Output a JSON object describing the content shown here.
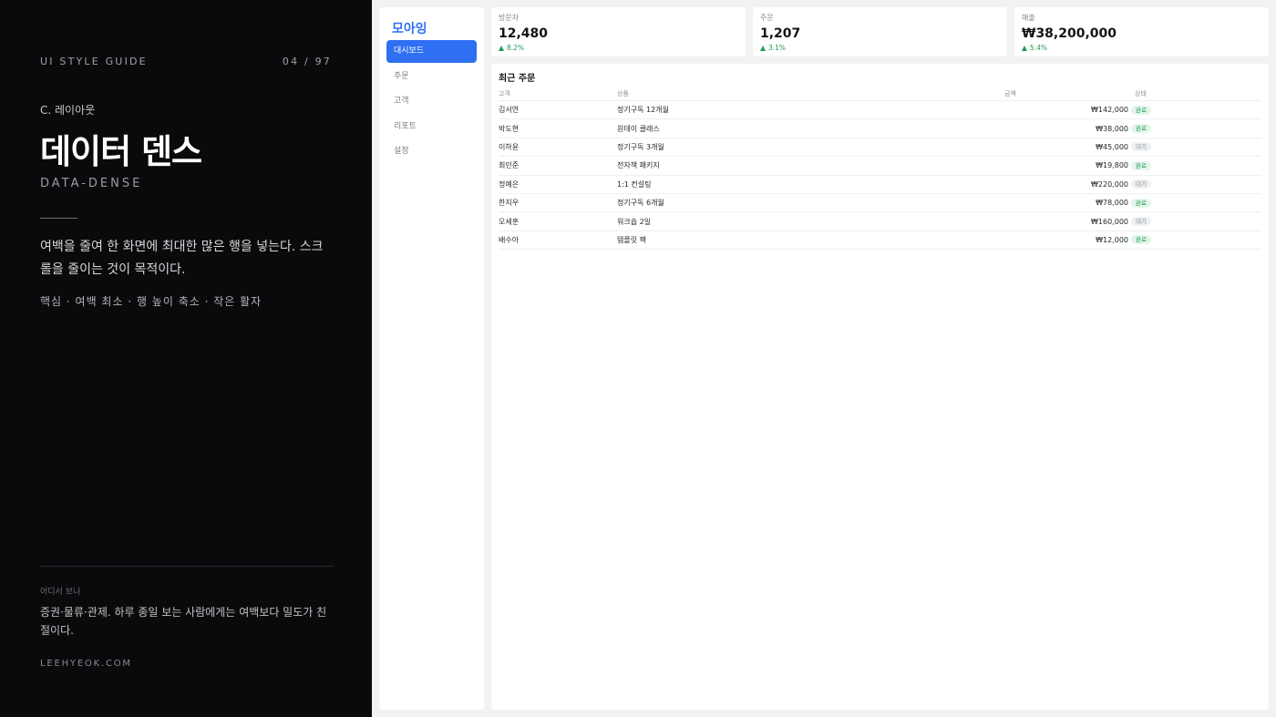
{
  "guide": {
    "label": "UI STYLE GUIDE",
    "page": "04 / 97",
    "section": "C. 레이아웃",
    "title": "데이터 덴스",
    "subtitle": "DATA-DENSE",
    "description": "여백을 줄여 한 화면에 최대한 많은 행을 넣는다. 스크롤을 줄이는 것이 목적이다.",
    "keywords": "핵심 · 여백 최소 · 행 높이 축소 · 작은 활자",
    "where_label": "어디서 보나",
    "where_text": "증권·물류·관제. 하루 종일 보는 사람에게는 여백보다 밀도가 친절이다.",
    "site": "LEEHYEOK.COM"
  },
  "app": {
    "brand": "모아잉",
    "nav": [
      {
        "label": "대시보드",
        "active": true
      },
      {
        "label": "주문",
        "active": false
      },
      {
        "label": "고객",
        "active": false
      },
      {
        "label": "리포트",
        "active": false
      },
      {
        "label": "설정",
        "active": false
      }
    ],
    "stats": [
      {
        "label": "방문자",
        "value": "12,480",
        "change": "8.2%"
      },
      {
        "label": "주문",
        "value": "1,207",
        "change": "3.1%"
      },
      {
        "label": "매출",
        "value": "₩38,200,000",
        "change": "5.4%"
      }
    ],
    "table": {
      "title": "최근 주문",
      "headers": [
        "고객",
        "상품",
        "금액",
        "상태"
      ],
      "rows": [
        [
          "김서연",
          "정기구독 12개월",
          "₩142,000",
          "완료"
        ],
        [
          "박도현",
          "원데이 클래스",
          "₩38,000",
          "완료"
        ],
        [
          "이하윤",
          "정기구독 3개월",
          "₩45,000",
          "대기"
        ],
        [
          "최민준",
          "전자책 패키지",
          "₩19,800",
          "완료"
        ],
        [
          "정예은",
          "1:1 컨설팅",
          "₩220,000",
          "대기"
        ],
        [
          "한지우",
          "정기구독 6개월",
          "₩78,000",
          "완료"
        ],
        [
          "오세훈",
          "워크숍 2일",
          "₩160,000",
          "대기"
        ],
        [
          "배수아",
          "템플릿 팩",
          "₩12,000",
          "완료"
        ]
      ]
    }
  }
}
